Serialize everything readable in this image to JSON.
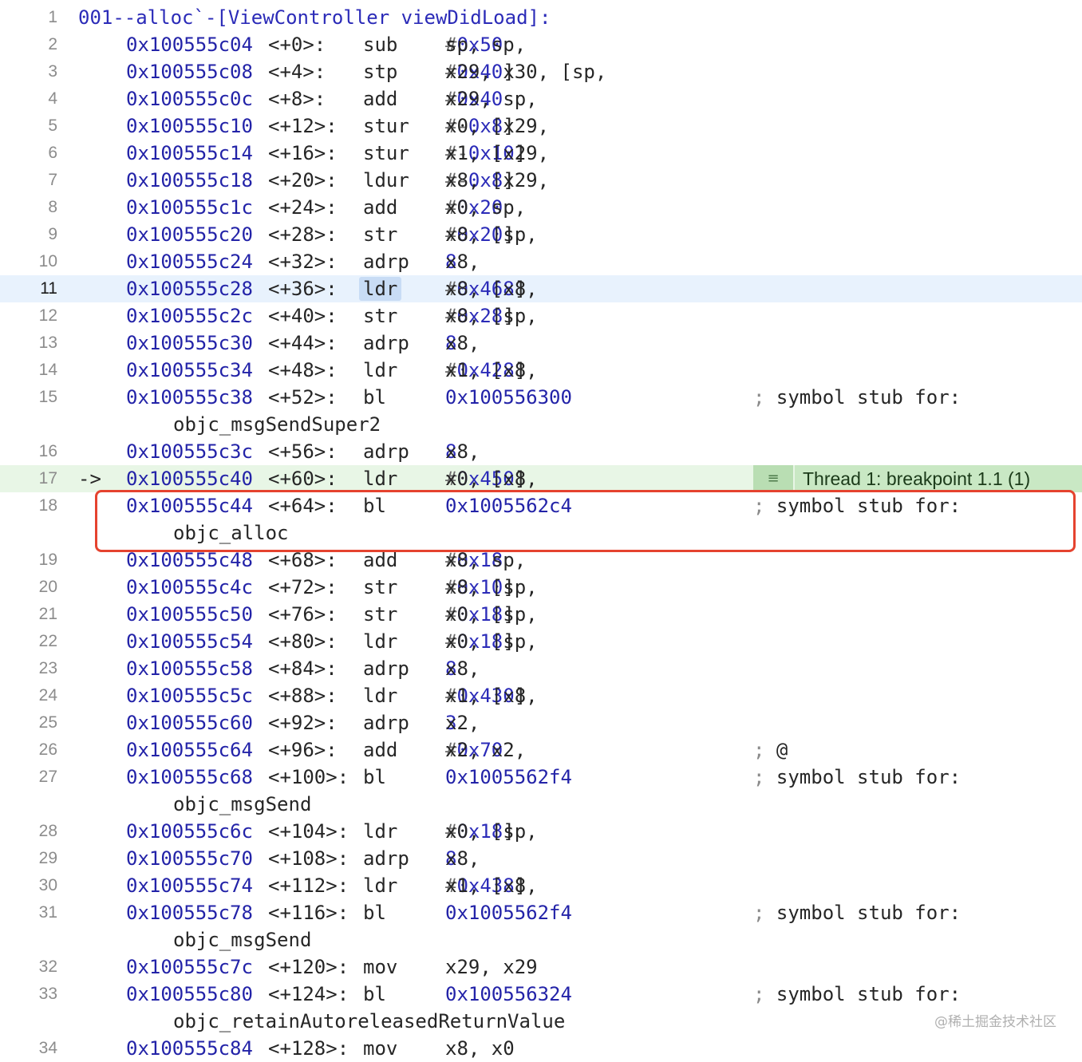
{
  "title_line": {
    "line_no": "1",
    "prefix": "001--alloc`",
    "function": "-[ViewController viewDidLoad]:"
  },
  "instructions": [
    {
      "ln": "2",
      "addr": "0x100555c04",
      "off": "<+0>:",
      "mn": "sub",
      "ops": [
        [
          "sp, sp, ",
          "t"
        ],
        [
          "#",
          "h"
        ],
        [
          "0x50",
          "i"
        ]
      ]
    },
    {
      "ln": "3",
      "addr": "0x100555c08",
      "off": "<+4>:",
      "mn": "stp",
      "ops": [
        [
          "x29, x30, [sp, ",
          "t"
        ],
        [
          "#",
          "h"
        ],
        [
          "0x40",
          "i"
        ],
        [
          "]",
          "t"
        ]
      ]
    },
    {
      "ln": "4",
      "addr": "0x100555c0c",
      "off": "<+8>:",
      "mn": "add",
      "ops": [
        [
          "x29, sp, ",
          "t"
        ],
        [
          "#",
          "h"
        ],
        [
          "0x40",
          "i"
        ]
      ]
    },
    {
      "ln": "5",
      "addr": "0x100555c10",
      "off": "<+12>:",
      "mn": "stur",
      "ops": [
        [
          "x0, [x29, ",
          "t"
        ],
        [
          "#-",
          "h"
        ],
        [
          "0x8",
          "i"
        ],
        [
          "]",
          "t"
        ]
      ]
    },
    {
      "ln": "6",
      "addr": "0x100555c14",
      "off": "<+16>:",
      "mn": "stur",
      "ops": [
        [
          "x1, [x29, ",
          "t"
        ],
        [
          "#-",
          "h"
        ],
        [
          "0x10",
          "i"
        ],
        [
          "]",
          "t"
        ]
      ]
    },
    {
      "ln": "7",
      "addr": "0x100555c18",
      "off": "<+20>:",
      "mn": "ldur",
      "ops": [
        [
          "x8, [x29, ",
          "t"
        ],
        [
          "#-",
          "h"
        ],
        [
          "0x8",
          "i"
        ],
        [
          "]",
          "t"
        ]
      ]
    },
    {
      "ln": "8",
      "addr": "0x100555c1c",
      "off": "<+24>:",
      "mn": "add",
      "ops": [
        [
          "x0, sp, ",
          "t"
        ],
        [
          "#",
          "h"
        ],
        [
          "0x20",
          "i"
        ]
      ]
    },
    {
      "ln": "9",
      "addr": "0x100555c20",
      "off": "<+28>:",
      "mn": "str",
      "ops": [
        [
          "x8, [sp, ",
          "t"
        ],
        [
          "#",
          "h"
        ],
        [
          "0x20",
          "i"
        ],
        [
          "]",
          "t"
        ]
      ]
    },
    {
      "ln": "10",
      "addr": "0x100555c24",
      "off": "<+32>:",
      "mn": "adrp",
      "ops": [
        [
          "x8, ",
          "t"
        ],
        [
          "8",
          "i"
        ]
      ]
    },
    {
      "ln": "11",
      "addr": "0x100555c28",
      "off": "<+36>:",
      "mn": "ldr",
      "ops": [
        [
          "x8, [x8, ",
          "t"
        ],
        [
          "#",
          "h"
        ],
        [
          "0x468",
          "i"
        ],
        [
          "]",
          "t"
        ]
      ],
      "current": true
    },
    {
      "ln": "12",
      "addr": "0x100555c2c",
      "off": "<+40>:",
      "mn": "str",
      "ops": [
        [
          "x8, [sp, ",
          "t"
        ],
        [
          "#",
          "h"
        ],
        [
          "0x28",
          "i"
        ],
        [
          "]",
          "t"
        ]
      ]
    },
    {
      "ln": "13",
      "addr": "0x100555c30",
      "off": "<+44>:",
      "mn": "adrp",
      "ops": [
        [
          "x8, ",
          "t"
        ],
        [
          "8",
          "i"
        ]
      ]
    },
    {
      "ln": "14",
      "addr": "0x100555c34",
      "off": "<+48>:",
      "mn": "ldr",
      "ops": [
        [
          "x1, [x8, ",
          "t"
        ],
        [
          "#",
          "h"
        ],
        [
          "0x428",
          "i"
        ],
        [
          "]",
          "t"
        ]
      ]
    },
    {
      "ln": "15",
      "addr": "0x100555c38",
      "off": "<+52>:",
      "mn": "bl",
      "target": "0x100556300",
      "comment": "symbol stub for:",
      "cont": "objc_msgSendSuper2"
    },
    {
      "ln": "16",
      "addr": "0x100555c3c",
      "off": "<+56>:",
      "mn": "adrp",
      "ops": [
        [
          "x8, ",
          "t"
        ],
        [
          "8",
          "i"
        ]
      ]
    },
    {
      "ln": "17",
      "addr": "0x100555c40",
      "off": "<+60>:",
      "mn": "ldr",
      "ops": [
        [
          "x0, [x8, ",
          "t"
        ],
        [
          "#",
          "h"
        ],
        [
          "0x450",
          "i"
        ],
        [
          "]",
          "t"
        ]
      ],
      "arrow": "->",
      "breakpoint": "Thread 1: breakpoint 1.1 (1)"
    },
    {
      "ln": "18",
      "addr": "0x100555c44",
      "off": "<+64>:",
      "mn": "bl",
      "target": "0x1005562c4",
      "comment": "symbol stub for:",
      "cont": "objc_alloc"
    },
    {
      "ln": "19",
      "addr": "0x100555c48",
      "off": "<+68>:",
      "mn": "add",
      "ops": [
        [
          "x8, sp, ",
          "t"
        ],
        [
          "#",
          "h"
        ],
        [
          "0x18",
          "i"
        ]
      ]
    },
    {
      "ln": "20",
      "addr": "0x100555c4c",
      "off": "<+72>:",
      "mn": "str",
      "ops": [
        [
          "x8, [sp, ",
          "t"
        ],
        [
          "#",
          "h"
        ],
        [
          "0x10",
          "i"
        ],
        [
          "]",
          "t"
        ]
      ]
    },
    {
      "ln": "21",
      "addr": "0x100555c50",
      "off": "<+76>:",
      "mn": "str",
      "ops": [
        [
          "x0, [sp, ",
          "t"
        ],
        [
          "#",
          "h"
        ],
        [
          "0x18",
          "i"
        ],
        [
          "]",
          "t"
        ]
      ]
    },
    {
      "ln": "22",
      "addr": "0x100555c54",
      "off": "<+80>:",
      "mn": "ldr",
      "ops": [
        [
          "x0, [sp, ",
          "t"
        ],
        [
          "#",
          "h"
        ],
        [
          "0x18",
          "i"
        ],
        [
          "]",
          "t"
        ]
      ]
    },
    {
      "ln": "23",
      "addr": "0x100555c58",
      "off": "<+84>:",
      "mn": "adrp",
      "ops": [
        [
          "x8, ",
          "t"
        ],
        [
          "8",
          "i"
        ]
      ]
    },
    {
      "ln": "24",
      "addr": "0x100555c5c",
      "off": "<+88>:",
      "mn": "ldr",
      "ops": [
        [
          "x1, [x8, ",
          "t"
        ],
        [
          "#",
          "h"
        ],
        [
          "0x430",
          "i"
        ],
        [
          "]",
          "t"
        ]
      ]
    },
    {
      "ln": "25",
      "addr": "0x100555c60",
      "off": "<+92>:",
      "mn": "adrp",
      "ops": [
        [
          "x2, ",
          "t"
        ],
        [
          "3",
          "i"
        ]
      ]
    },
    {
      "ln": "26",
      "addr": "0x100555c64",
      "off": "<+96>:",
      "mn": "add",
      "ops": [
        [
          "x2, x2, ",
          "t"
        ],
        [
          "#",
          "h"
        ],
        [
          "0x70",
          "i"
        ]
      ],
      "comment": "@"
    },
    {
      "ln": "27",
      "addr": "0x100555c68",
      "off": "<+100>:",
      "mn": "bl",
      "target": "0x1005562f4",
      "comment": "symbol stub for:",
      "cont": "objc_msgSend"
    },
    {
      "ln": "28",
      "addr": "0x100555c6c",
      "off": "<+104>:",
      "mn": "ldr",
      "ops": [
        [
          "x0, [sp, ",
          "t"
        ],
        [
          "#",
          "h"
        ],
        [
          "0x18",
          "i"
        ],
        [
          "]",
          "t"
        ]
      ]
    },
    {
      "ln": "29",
      "addr": "0x100555c70",
      "off": "<+108>:",
      "mn": "adrp",
      "ops": [
        [
          "x8, ",
          "t"
        ],
        [
          "8",
          "i"
        ]
      ]
    },
    {
      "ln": "30",
      "addr": "0x100555c74",
      "off": "<+112>:",
      "mn": "ldr",
      "ops": [
        [
          "x1, [x8, ",
          "t"
        ],
        [
          "#",
          "h"
        ],
        [
          "0x438",
          "i"
        ],
        [
          "]",
          "t"
        ]
      ]
    },
    {
      "ln": "31",
      "addr": "0x100555c78",
      "off": "<+116>:",
      "mn": "bl",
      "target": "0x1005562f4",
      "comment": "symbol stub for:",
      "cont": "objc_msgSend"
    },
    {
      "ln": "32",
      "addr": "0x100555c7c",
      "off": "<+120>:",
      "mn": "mov",
      "ops": [
        [
          "x29, x29",
          "t"
        ]
      ]
    },
    {
      "ln": "33",
      "addr": "0x100555c80",
      "off": "<+124>:",
      "mn": "bl",
      "target": "0x100556324",
      "comment": "symbol stub for:",
      "cont": "objc_retainAutoreleasedReturnValue"
    },
    {
      "ln": "34",
      "addr": "0x100555c84",
      "off": "<+128>:",
      "mn": "mov",
      "ops": [
        [
          "x8, x0",
          "t"
        ]
      ]
    }
  ],
  "watermark": "@稀土掘金技术社区",
  "colors": {
    "highlight_box": "#e5432f",
    "current_line": "#e8f2fd",
    "breakpoint_line": "#e8f6e6",
    "address": "#2323a8"
  }
}
